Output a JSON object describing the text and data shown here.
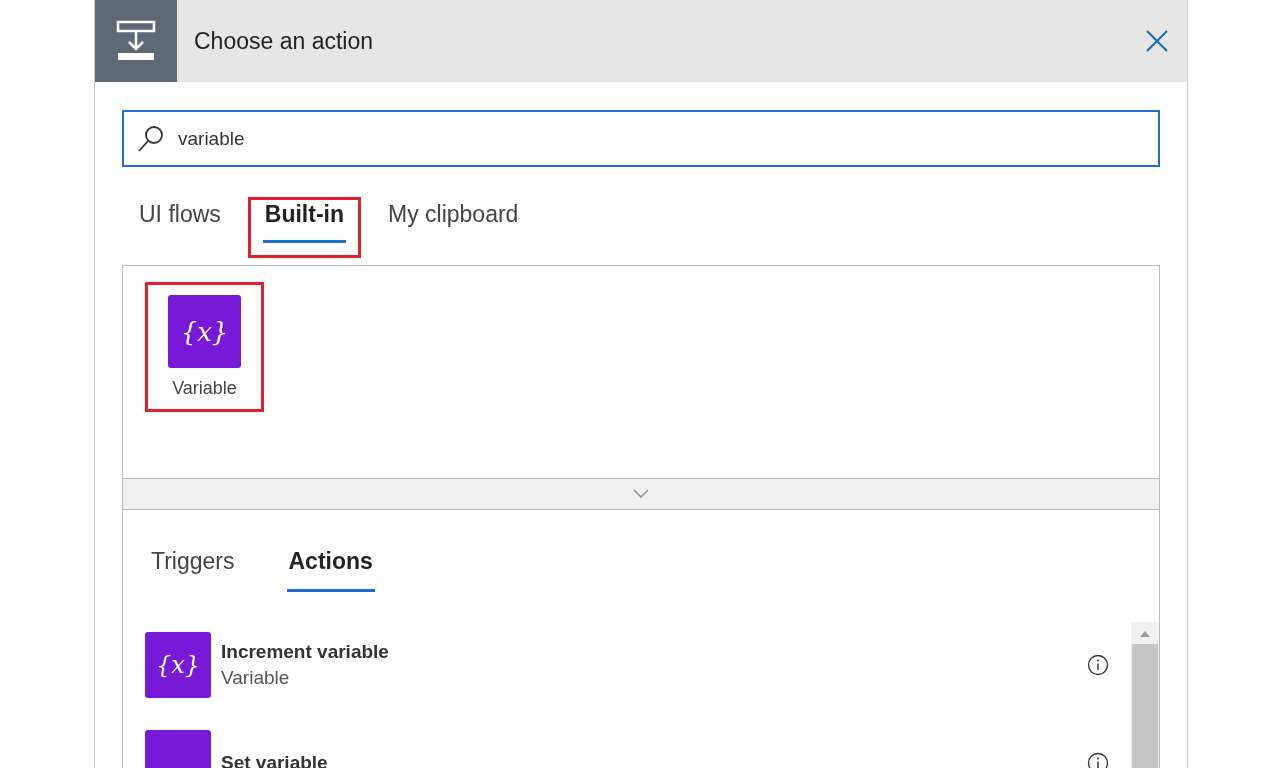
{
  "window": {
    "title": "Choose an action"
  },
  "search": {
    "value": "variable"
  },
  "tabs": [
    {
      "label": "UI flows",
      "selected": false,
      "highlighted": false
    },
    {
      "label": "Built-in",
      "selected": true,
      "highlighted": true
    },
    {
      "label": "My clipboard",
      "selected": false,
      "highlighted": false
    }
  ],
  "connectors": [
    {
      "glyph": "{x}",
      "label": "Variable",
      "highlighted": true
    }
  ],
  "action_tabs": [
    {
      "label": "Triggers",
      "selected": false
    },
    {
      "label": "Actions",
      "selected": true
    }
  ],
  "actions": [
    {
      "glyph": "{x}",
      "title": "Increment variable",
      "subtitle": "Variable"
    },
    {
      "title": "Set variable"
    }
  ]
}
